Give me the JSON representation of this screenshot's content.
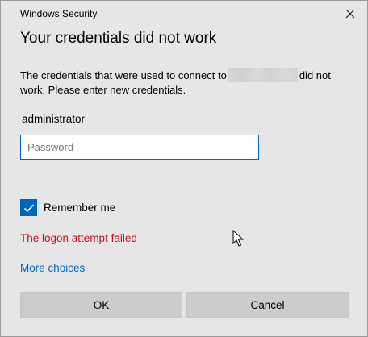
{
  "window": {
    "title": "Windows Security"
  },
  "dialog": {
    "heading": "Your credentials did not work",
    "message_before": "The credentials that were used to connect to",
    "message_after": "did not work. Please enter new credentials.",
    "username": "administrator",
    "password_placeholder": "Password",
    "remember_label": "Remember me",
    "remember_checked": true,
    "error_text": "The logon attempt failed",
    "more_choices": "More choices"
  },
  "buttons": {
    "ok_label": "OK",
    "cancel_label": "Cancel"
  },
  "colors": {
    "accent": "#0067c0",
    "error": "#c50f1f",
    "background": "#e6e6e6",
    "button": "#cccccc"
  }
}
